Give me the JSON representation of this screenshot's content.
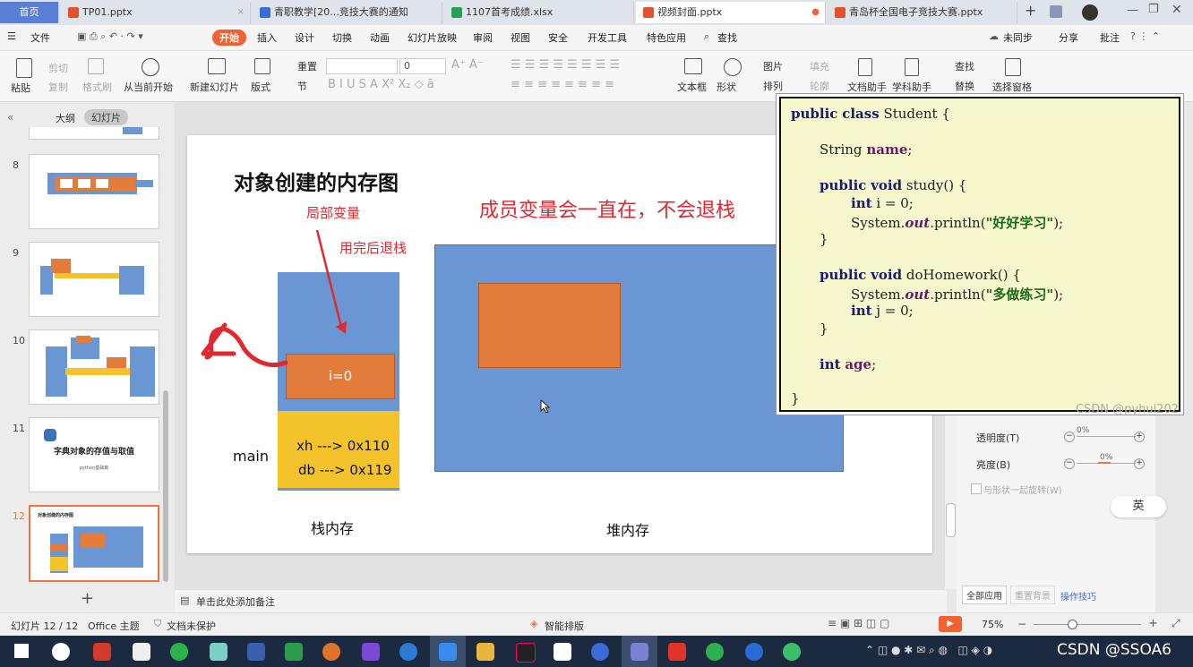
{
  "tabs": [
    {
      "label": "首页"
    },
    {
      "label": "TP01.pptx"
    },
    {
      "label": "青职教学[20...竞技大赛的通知"
    },
    {
      "label": "1107首考成绩.xlsx"
    },
    {
      "label": "视频封面.pptx"
    },
    {
      "label": "青岛杯全国电子竞技大赛.pptx"
    }
  ],
  "tab_plus": "+",
  "menu": {
    "file": "文件",
    "items": [
      "开始",
      "插入",
      "设计",
      "切换",
      "动画",
      "幻灯片放映",
      "审阅",
      "视图",
      "安全",
      "开发工具",
      "特色应用"
    ],
    "search": "查找",
    "sync": "未同步",
    "share": "分享",
    "comment": "批注"
  },
  "ribbon": {
    "paste": "粘贴",
    "cut": "剪切",
    "copy": "复制",
    "format_painter": "格式刷",
    "from_current": "从当前开始",
    "new_slide": "新建幻灯片",
    "layout": "版式",
    "reset": "重置",
    "section": "节",
    "font_size": "0",
    "text_box": "文本框",
    "shape": "形状",
    "picture": "图片",
    "fill": "填充",
    "arrange": "排列",
    "outline": "轮廓",
    "doc_helper": "文档助手",
    "subject_helper": "学科助手",
    "find": "查找",
    "replace": "替换",
    "select_pane": "选择窗格"
  },
  "leftpanel": {
    "outline_tab": "大纲",
    "slides_tab": "幻灯片",
    "thumbs": [
      {
        "num": "8"
      },
      {
        "num": "9"
      },
      {
        "num": "10"
      },
      {
        "num": "11",
        "title": "字典对象的存值与取值",
        "sub": "python基础篇"
      },
      {
        "num": "12",
        "title": "对象创建的内存图"
      }
    ],
    "add": "+"
  },
  "slide": {
    "title": "对象创建的内存图",
    "local_var": "局部变量",
    "pop_after": "用完后退栈",
    "member_note": "成员变量会一直在，不会退栈",
    "i_label": "i=0",
    "xh": "xh ---> 0x110",
    "db": "db ---> 0x119",
    "main": "main",
    "stack": "栈内存",
    "heap": "堆内存"
  },
  "code": {
    "l1": [
      "public",
      "class",
      "Student {"
    ],
    "l2": [
      "String",
      "name",
      ";"
    ],
    "l3": [
      "public",
      "void",
      "study() {"
    ],
    "l4": [
      "int",
      "i = 0;"
    ],
    "l5": [
      "System.",
      "out",
      ".println(",
      "\"好好学习\"",
      ");"
    ],
    "l6": "}",
    "l7": [
      "public",
      "void",
      "doHomework() {"
    ],
    "l8": [
      "System.",
      "out",
      ".println(",
      "\"多做练习\"",
      ");"
    ],
    "l9": [
      "int",
      "j = 0;"
    ],
    "l10": "}",
    "l11": [
      "int",
      "age",
      ";"
    ],
    "l12": "}",
    "watermark": "CSDN @pyhui202"
  },
  "rightpane": {
    "transparency": "透明度(T)",
    "transparency_val": "0%",
    "brightness": "亮度(B)",
    "brightness_val": "0%",
    "rotate": "与形状一起旋转(W)",
    "ime": "英",
    "apply_all": "全部应用",
    "reset_bg": "重置背景",
    "tips": "操作技巧"
  },
  "notes": "单击此处添加备注",
  "status": {
    "slide_count": "幻灯片 12 / 12",
    "theme": "Office 主题",
    "protect": "文档未保护",
    "smart": "智能排版",
    "zoom": "75%"
  },
  "taskbar": {
    "watermark": "CSDN @SSOA6"
  },
  "colors": {
    "accent": "#f4602e",
    "slide_blue": "#6a97d4",
    "slide_orange": "#e27c3a",
    "slide_yellow": "#f4c22b",
    "red": "#e0282e"
  }
}
